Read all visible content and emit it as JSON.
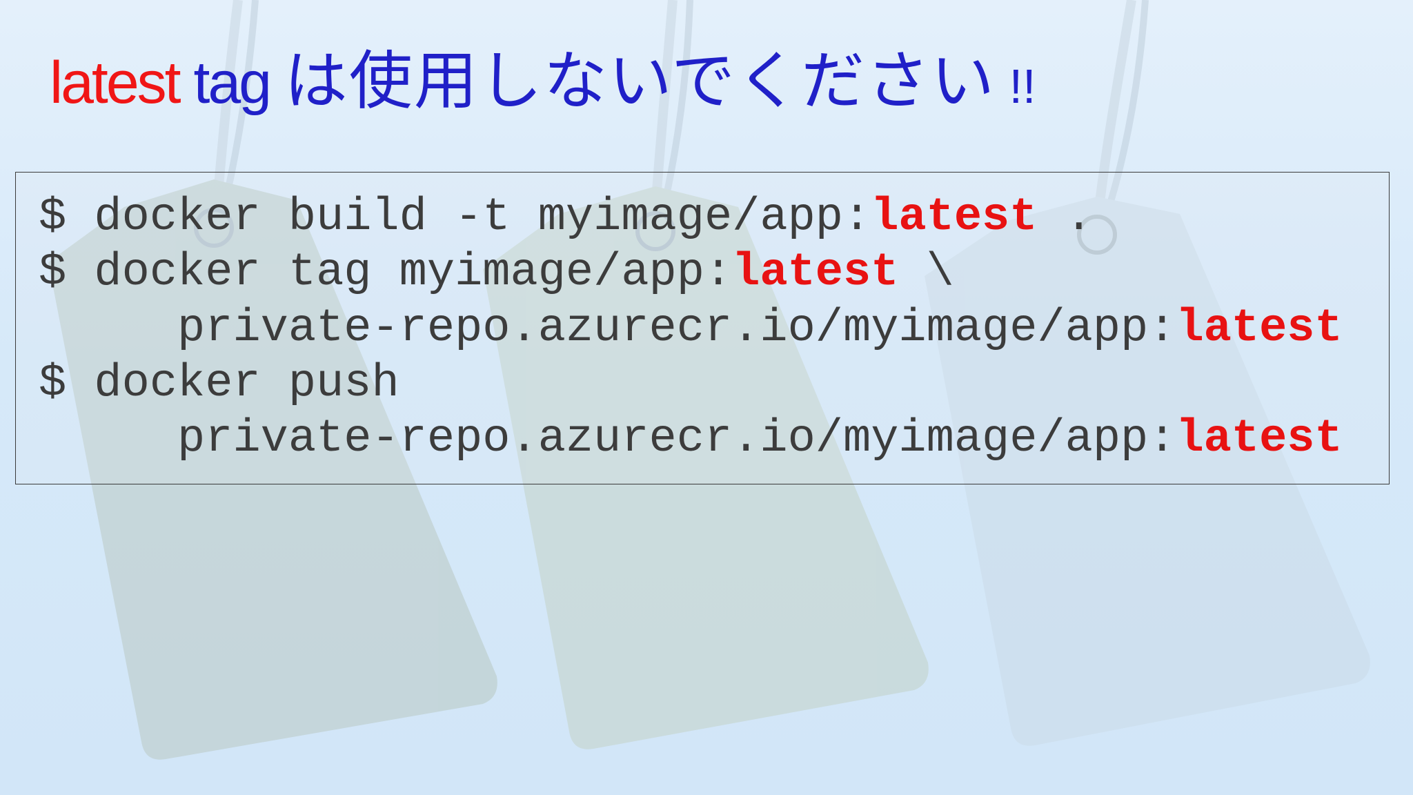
{
  "title": {
    "latest_word": "latest",
    "tag_word": " tag ",
    "japanese": "は使用しないでください",
    "exclamation": " !!"
  },
  "code": {
    "lines": [
      {
        "prefix": "$ docker build -t myimage/app:",
        "keyword": "latest",
        "suffix": " ."
      },
      {
        "prefix": "$ docker tag myimage/app:",
        "keyword": "latest",
        "suffix": " \\"
      },
      {
        "prefix": "     private-repo.azurecr.io/myimage/app:",
        "keyword": "latest",
        "suffix": ""
      },
      {
        "prefix": "$ docker push",
        "keyword": "",
        "suffix": ""
      },
      {
        "prefix": "     private-repo.azurecr.io/myimage/app:",
        "keyword": "latest",
        "suffix": ""
      }
    ]
  },
  "colors": {
    "title_red": "#f01616",
    "title_blue": "#2020c8",
    "code_text": "#3c3c3c",
    "code_keyword": "#e81212"
  }
}
